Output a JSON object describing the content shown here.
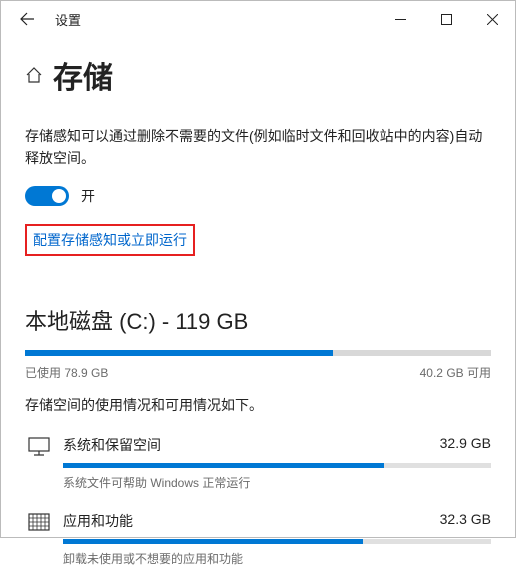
{
  "window": {
    "title": "设置"
  },
  "page": {
    "title": "存储",
    "description": "存储感知可以通过删除不需要的文件(例如临时文件和回收站中的内容)自动释放空间。",
    "toggle_label": "开",
    "configure_link": "配置存储感知或立即运行"
  },
  "disk": {
    "title": "本地磁盘 (C:) - 119 GB",
    "used_label": "已使用 78.9 GB",
    "free_label": "40.2 GB 可用",
    "fill_percent": 66,
    "sub_desc": "存储空间的使用情况和可用情况如下。"
  },
  "categories": [
    {
      "name": "系统和保留空间",
      "size": "32.9 GB",
      "note": "系统文件可帮助 Windows 正常运行",
      "fill_percent": 75,
      "icon": "monitor"
    },
    {
      "name": "应用和功能",
      "size": "32.3 GB",
      "note": "卸载未使用或不想要的应用和功能",
      "fill_percent": 70,
      "icon": "grid"
    }
  ]
}
